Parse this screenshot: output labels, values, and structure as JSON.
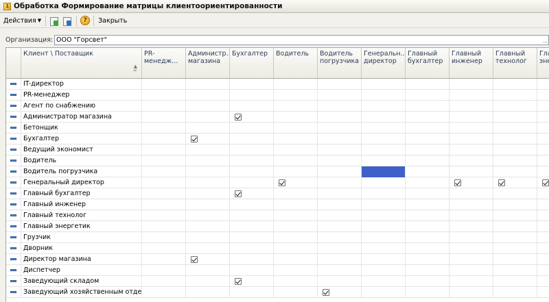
{
  "window": {
    "title": "Обработка  Формирование матрицы клиентоориентированности"
  },
  "toolbar": {
    "actions_label": "Действия",
    "close_label": "Закрыть"
  },
  "org": {
    "label": "Организация:",
    "value": "ООО \"Горсвет\""
  },
  "grid": {
    "corner_header": "Клиент \\ Поставщик",
    "columns": [
      "PR-менедж...",
      "Администр...\nмагазина",
      "Бухгалтер",
      "Водитель",
      "Водитель\nпогрузчика",
      "Генеральн...\nдиректор",
      "Главный\nбухгалтер",
      "Главный\nинженер",
      "Главный\nтехнолог",
      "Гла\nэне"
    ],
    "rows": [
      {
        "name": "IT-директор",
        "checks": []
      },
      {
        "name": "PR-менеджер",
        "checks": []
      },
      {
        "name": "Агент по снабжению",
        "checks": []
      },
      {
        "name": "Администратор магазина",
        "checks": [
          2
        ]
      },
      {
        "name": "Бетонщик",
        "checks": []
      },
      {
        "name": "Бухгалтер",
        "checks": [
          1
        ]
      },
      {
        "name": "Ведущий экономист",
        "checks": []
      },
      {
        "name": "Водитель",
        "checks": []
      },
      {
        "name": "Водитель погрузчика",
        "checks": [],
        "selected": 5
      },
      {
        "name": "Генеральный директор",
        "checks": [
          3,
          7,
          8,
          9
        ]
      },
      {
        "name": "Главный бухгалтер",
        "checks": [
          2
        ]
      },
      {
        "name": "Главный инженер",
        "checks": []
      },
      {
        "name": "Главный технолог",
        "checks": []
      },
      {
        "name": "Главный энергетик",
        "checks": []
      },
      {
        "name": "Грузчик",
        "checks": []
      },
      {
        "name": "Дворник",
        "checks": []
      },
      {
        "name": "Директор магазина",
        "checks": [
          1
        ]
      },
      {
        "name": "Диспетчер",
        "checks": []
      },
      {
        "name": "Заведующий складом",
        "checks": [
          2
        ]
      },
      {
        "name": "Заведующий хозяйственным отдел...",
        "checks": [
          4
        ]
      }
    ]
  }
}
